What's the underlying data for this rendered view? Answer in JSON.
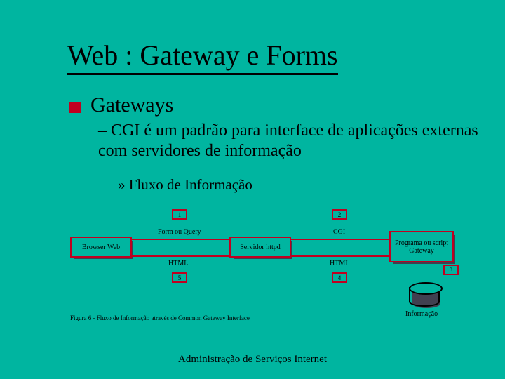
{
  "title": "Web : Gateway e Forms",
  "bullet": "Gateways",
  "sub1": "– CGI é um padrão para interface de aplicações externas com servidores de informação",
  "sub2": "» Fluxo de Informação",
  "boxes": {
    "browser": "Browser Web",
    "server": "Servidor httpd",
    "gateway": "Programa ou script Gateway"
  },
  "edge_labels": {
    "form": "Form ou Query",
    "cgi": "CGI",
    "html_left": "HTML",
    "html_right": "HTML"
  },
  "numbers": {
    "n1": "1",
    "n2": "2",
    "n3": "3",
    "n4": "4",
    "n5": "5"
  },
  "db_label": "Informação",
  "caption": "Figura 6 - Fluxo de Informação através de Common Gateway Interface",
  "footer": "Administração de Serviços Internet"
}
